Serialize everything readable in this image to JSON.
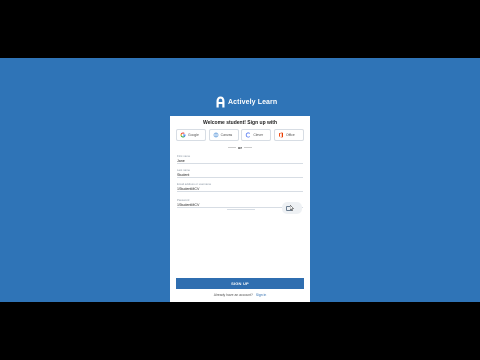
{
  "brand": {
    "name": "Actively Learn"
  },
  "form": {
    "welcome": "Welcome student! Sign up with",
    "providers": [
      {
        "label": "Google",
        "icon": "google-icon"
      },
      {
        "label": "Canvas",
        "icon": "canvas-icon"
      },
      {
        "label": "Clever",
        "icon": "clever-icon"
      },
      {
        "label": "Office",
        "icon": "office-icon"
      }
    ],
    "or_label": "or",
    "fields": [
      {
        "label": "First name",
        "value": "Jane"
      },
      {
        "label": "Last name",
        "value": "Student"
      },
      {
        "label": "Email address or username",
        "value": "1StudentMCV"
      },
      {
        "label": "Password",
        "value": "1StudentMCV"
      }
    ],
    "submit": "SIGN UP",
    "already_text": "Already have an account?",
    "sign_in": "Sign in"
  },
  "colors": {
    "background": "#2f74b7",
    "button": "#2f6eb0",
    "card": "#ffffff"
  }
}
